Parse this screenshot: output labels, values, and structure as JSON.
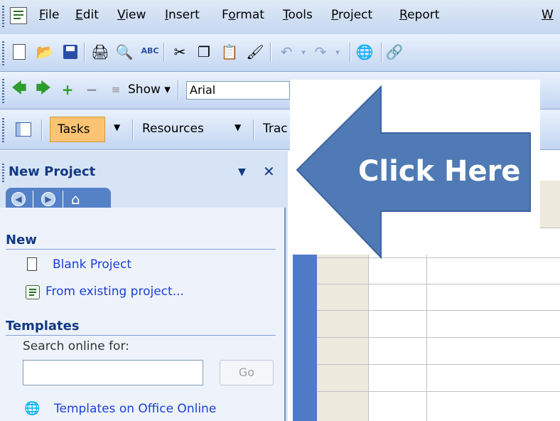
{
  "menubar": {
    "items": [
      {
        "label": "File",
        "u": "F",
        "rest": "ile"
      },
      {
        "label": "Edit",
        "u": "E",
        "rest": "dit"
      },
      {
        "label": "View",
        "u": "V",
        "rest": "iew"
      },
      {
        "label": "Insert",
        "u": "I",
        "rest": "nsert"
      },
      {
        "label": "Format",
        "pre": "F",
        "u": "o",
        "rest": "rmat"
      },
      {
        "label": "Tools",
        "u": "T",
        "rest": "ools"
      },
      {
        "label": "Project",
        "u": "P",
        "rest": "roject"
      },
      {
        "label": "Report",
        "u": "R",
        "rest": "eport"
      },
      {
        "label": "W",
        "u": "W",
        "rest": ""
      }
    ]
  },
  "formatting_toolbar": {
    "show_label": "Show",
    "font_value": "Arial"
  },
  "views_toolbar": {
    "tasks_label": "Tasks",
    "resources_label": "Resources",
    "track_label": "Trac"
  },
  "task_pane": {
    "title": "New Project",
    "new_header": "New",
    "blank_project": "Blank Project",
    "from_existing": "From existing project...",
    "templates_header": "Templates",
    "search_label": "Search online for:",
    "search_value": "",
    "go_label": "Go",
    "templates_online": "Templates on Office Online"
  },
  "callout": {
    "text": "Click Here",
    "color": "#4f7ab5"
  }
}
